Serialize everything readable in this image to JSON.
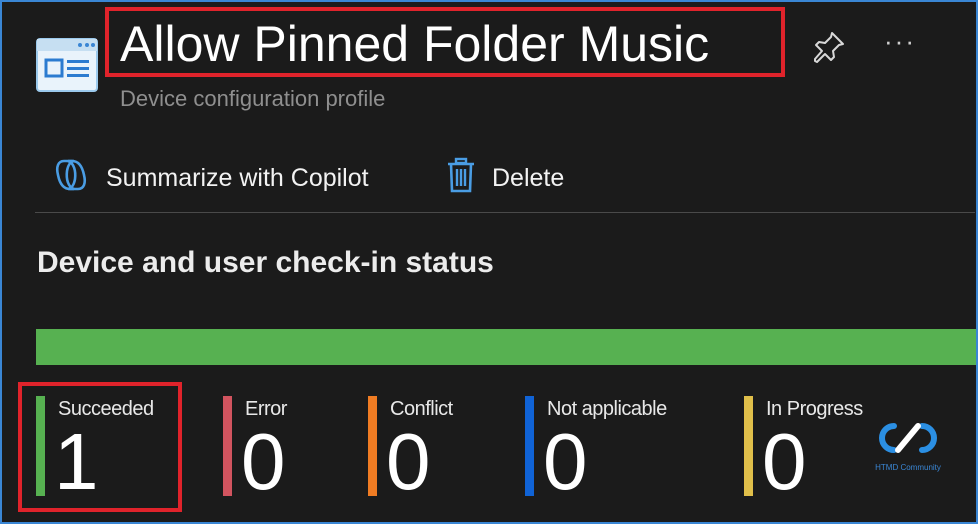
{
  "header": {
    "title": "Allow Pinned Folder Music",
    "subtitle": "Device configuration profile"
  },
  "toolbar": {
    "copilot_label": "Summarize with Copilot",
    "delete_label": "Delete"
  },
  "section": {
    "title": "Device and user check-in status"
  },
  "status_bar": {
    "succeeded_fraction": 1.0,
    "color": "#57b151"
  },
  "stats": [
    {
      "label": "Succeeded",
      "value": "1",
      "color": "#57b151"
    },
    {
      "label": "Error",
      "value": "0",
      "color": "#d2545f"
    },
    {
      "label": "Conflict",
      "value": "0",
      "color": "#f07c23"
    },
    {
      "label": "Not applicable",
      "value": "0",
      "color": "#1063d6"
    },
    {
      "label": "In Progress",
      "value": "0",
      "color": "#e0bf4a"
    }
  ],
  "icons": {
    "profile": "profile-window-icon",
    "pin": "pin-icon",
    "more": "more-icon",
    "copilot": "copilot-icon",
    "delete": "trash-icon"
  },
  "accent_colors": {
    "highlight": "#e0232b",
    "frame": "#3a86d4"
  },
  "watermark": {
    "text": "HTMD Community"
  }
}
